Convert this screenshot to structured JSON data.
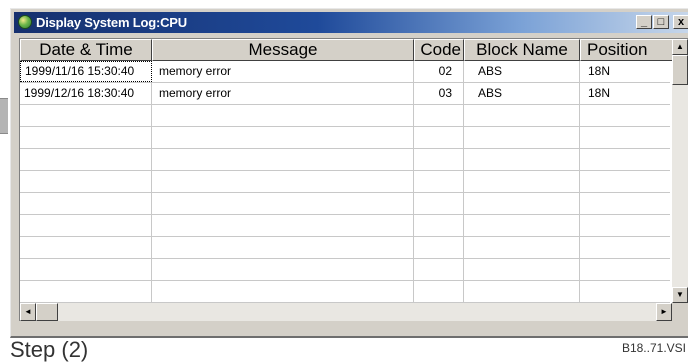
{
  "window": {
    "title": "Display System Log:CPU",
    "buttons": {
      "minimize": "_",
      "maximize": "□",
      "close": "x"
    }
  },
  "table": {
    "columns": [
      "Date & Time",
      "Message",
      "Code",
      "Block Name",
      "Position"
    ],
    "rows": [
      {
        "datetime": "1999/11/16 15:30:40",
        "message": "memory error",
        "code": "02",
        "block": "ABS",
        "position": "18N"
      },
      {
        "datetime": "1999/12/16 18:30:40",
        "message": "memory error",
        "code": "03",
        "block": "ABS",
        "position": "18N"
      }
    ],
    "empty_row_count": 9
  },
  "scrollbars": {
    "up": "▲",
    "down": "▼",
    "left": "◄",
    "right": "►"
  },
  "caption": {
    "step": "Step (2)",
    "figure_code": "B18..71.VSI"
  }
}
